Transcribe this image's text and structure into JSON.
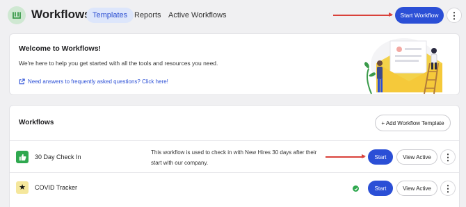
{
  "header": {
    "app_title": "Workflows",
    "tabs": [
      {
        "label": "Templates",
        "active": true
      },
      {
        "label": "Reports",
        "active": false
      },
      {
        "label": "Active Workflows",
        "active": false
      }
    ],
    "start_workflow_label": "Start Workflow",
    "more_icon": "vertical-ellipsis-icon"
  },
  "welcome": {
    "title": "Welcome to Workflows!",
    "text": "We're here to help you get started with all the tools and resources you need.",
    "help_link": "Need answers to frequently asked questions? Click here!",
    "help_icon": "external-link-icon"
  },
  "workflows": {
    "heading": "Workflows",
    "add_template_label": "+ Add Workflow Template",
    "rows": [
      {
        "icon": "thumbs-up-icon",
        "icon_color": "#2fa84f",
        "name": "30 Day Check In",
        "description": "This workflow is used to check in with New Hires 30 days after their start with our company.",
        "start_label": "Start",
        "view_active_label": "View Active"
      },
      {
        "icon": "star-icon",
        "icon_color": "#f5e79c",
        "name": "COVID Tracker",
        "description": "",
        "status_icon": "check-circle-icon",
        "start_label": "Start",
        "view_active_label": "View Active"
      }
    ]
  },
  "colors": {
    "primary": "#2b4fd6",
    "active_tab_bg": "#dde6fb",
    "annotation_arrow": "#d9413a",
    "page_bg": "#f0f0f2"
  }
}
